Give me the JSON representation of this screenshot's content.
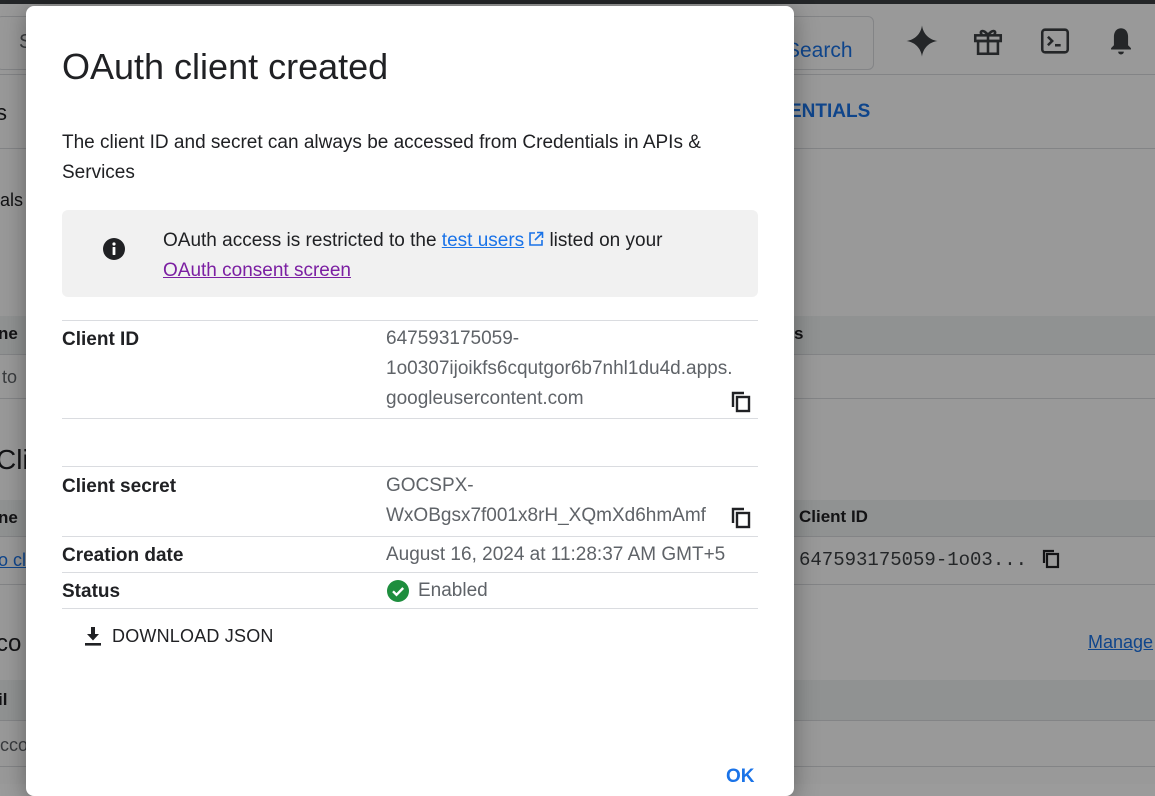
{
  "background": {
    "search_placeholder": "S",
    "search_button": "Search",
    "header_icons": [
      "gemini-sparkle-icon",
      "gift-icon",
      "cloud-shell-terminal-icon",
      "notifications-bell-icon"
    ],
    "tab_partial": "ENTIALS",
    "left_fragment_1": "s",
    "left_fragment_2": "ials",
    "left_fragment_3": "ne",
    "left_fragment_4": "to",
    "section_fragment": "Cli",
    "left_fragment_5": "ne",
    "left_link_fragment": "o cl",
    "left_fragment_6": "co",
    "left_fragment_7": "il",
    "left_fragment_8": "cco",
    "column_header_fragment": "s",
    "client_id_header": "Client ID",
    "client_id_value": "647593175059-1o03...",
    "manage_link": "Manage"
  },
  "dialog": {
    "title": "OAuth client created",
    "description": "The client ID and secret can always be accessed from Credentials in APIs & Services",
    "info": {
      "text_before": "OAuth access is restricted to the ",
      "test_users_link": "test users",
      "text_after": " listed on your ",
      "consent_link": "OAuth consent screen"
    },
    "fields": {
      "client_id": {
        "label": "Client ID",
        "value_line1": "647593175059-",
        "value_line2": "1o0307ijoikfs6cqutgor6b7nhl1du4d.apps.",
        "value_line3": "googleusercontent.com"
      },
      "client_secret": {
        "label": "Client secret",
        "value_line1": "GOCSPX-",
        "value_line2": "WxOBgsx7f001x8rH_XQmXd6hmAmf"
      },
      "creation_date": {
        "label": "Creation date",
        "value": "August 16, 2024 at 11:28:37 AM GMT+5"
      },
      "status": {
        "label": "Status",
        "value": "Enabled"
      }
    },
    "download_label": "DOWNLOAD JSON",
    "ok_label": "OK"
  },
  "colors": {
    "accent_blue": "#1a73e8",
    "visited_link": "#7b1fa2",
    "success_green": "#1e8e3e",
    "scrim": "rgba(0,0,0,0.40)"
  }
}
